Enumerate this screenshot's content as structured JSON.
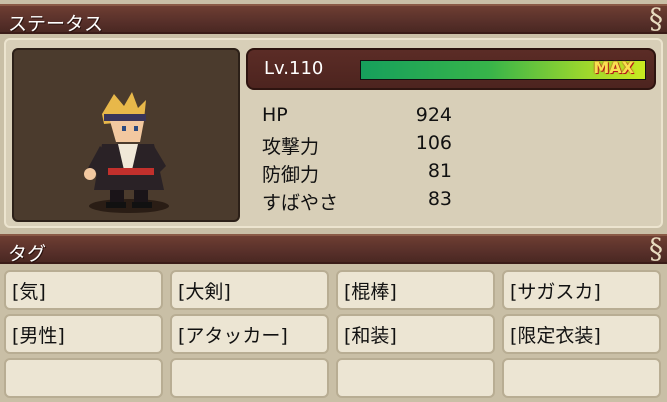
{
  "status_header": {
    "title": "ステータス"
  },
  "level": {
    "label": "Lv.110",
    "progress": 1.0,
    "max_label": "MAX"
  },
  "stats": [
    {
      "label": "HP",
      "value": "924"
    },
    {
      "label": "攻撃力",
      "value": "106"
    },
    {
      "label": "防御力",
      "value": "81"
    },
    {
      "label": "すばやさ",
      "value": "83"
    }
  ],
  "tag_header": {
    "title": "タグ"
  },
  "tags": [
    "[気]",
    "[大剣]",
    "[棍棒]",
    "[サガスカ]",
    "[男性]",
    "[アタッカー]",
    "[和装]",
    "[限定衣装]",
    "",
    "",
    "",
    ""
  ],
  "colors": {
    "header_bg": "#58302a",
    "panel_bg": "#d8cfb8",
    "gauge_fill": "#37b44a",
    "max_text": "#f8e050"
  }
}
